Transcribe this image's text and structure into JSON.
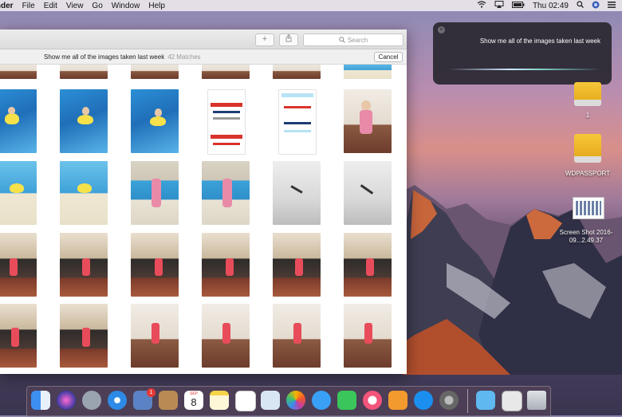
{
  "menubar": {
    "app_name": "Finder",
    "items": [
      "File",
      "Edit",
      "View",
      "Go",
      "Window",
      "Help"
    ],
    "clock": "Thu 02:49"
  },
  "photos_window": {
    "search_placeholder": "Search",
    "query_text": "Show me all of the images taken last week",
    "matches": "42 Matches",
    "cancel_label": "Cancel"
  },
  "siri": {
    "utterance": "Show me all of the images taken last week"
  },
  "desktop": {
    "icons": [
      {
        "label": "1"
      },
      {
        "label": "WDPASSPORT"
      },
      {
        "label": "Screen Shot 2016-09...2.49.37"
      }
    ]
  },
  "dock": {
    "calendar_month": "SEP",
    "calendar_day": "8",
    "mail_badge": "1",
    "apps": [
      "finder-icon",
      "siri-icon",
      "launchpad-icon",
      "safari-icon",
      "mail-icon",
      "contacts-icon",
      "calendar-icon",
      "notes-icon",
      "reminders-icon",
      "preview-icon",
      "photos-icon",
      "messages-icon",
      "facetime-icon",
      "itunes-icon",
      "ibooks-icon",
      "app-store-icon",
      "system-preferences-icon",
      "downloads-folder-icon",
      "screenshot-stack-icon",
      "trash-icon"
    ]
  },
  "colors": {
    "siri_panel": "#2a2830",
    "menubar": "#ebe6ec",
    "window": "#f4f4f4"
  }
}
